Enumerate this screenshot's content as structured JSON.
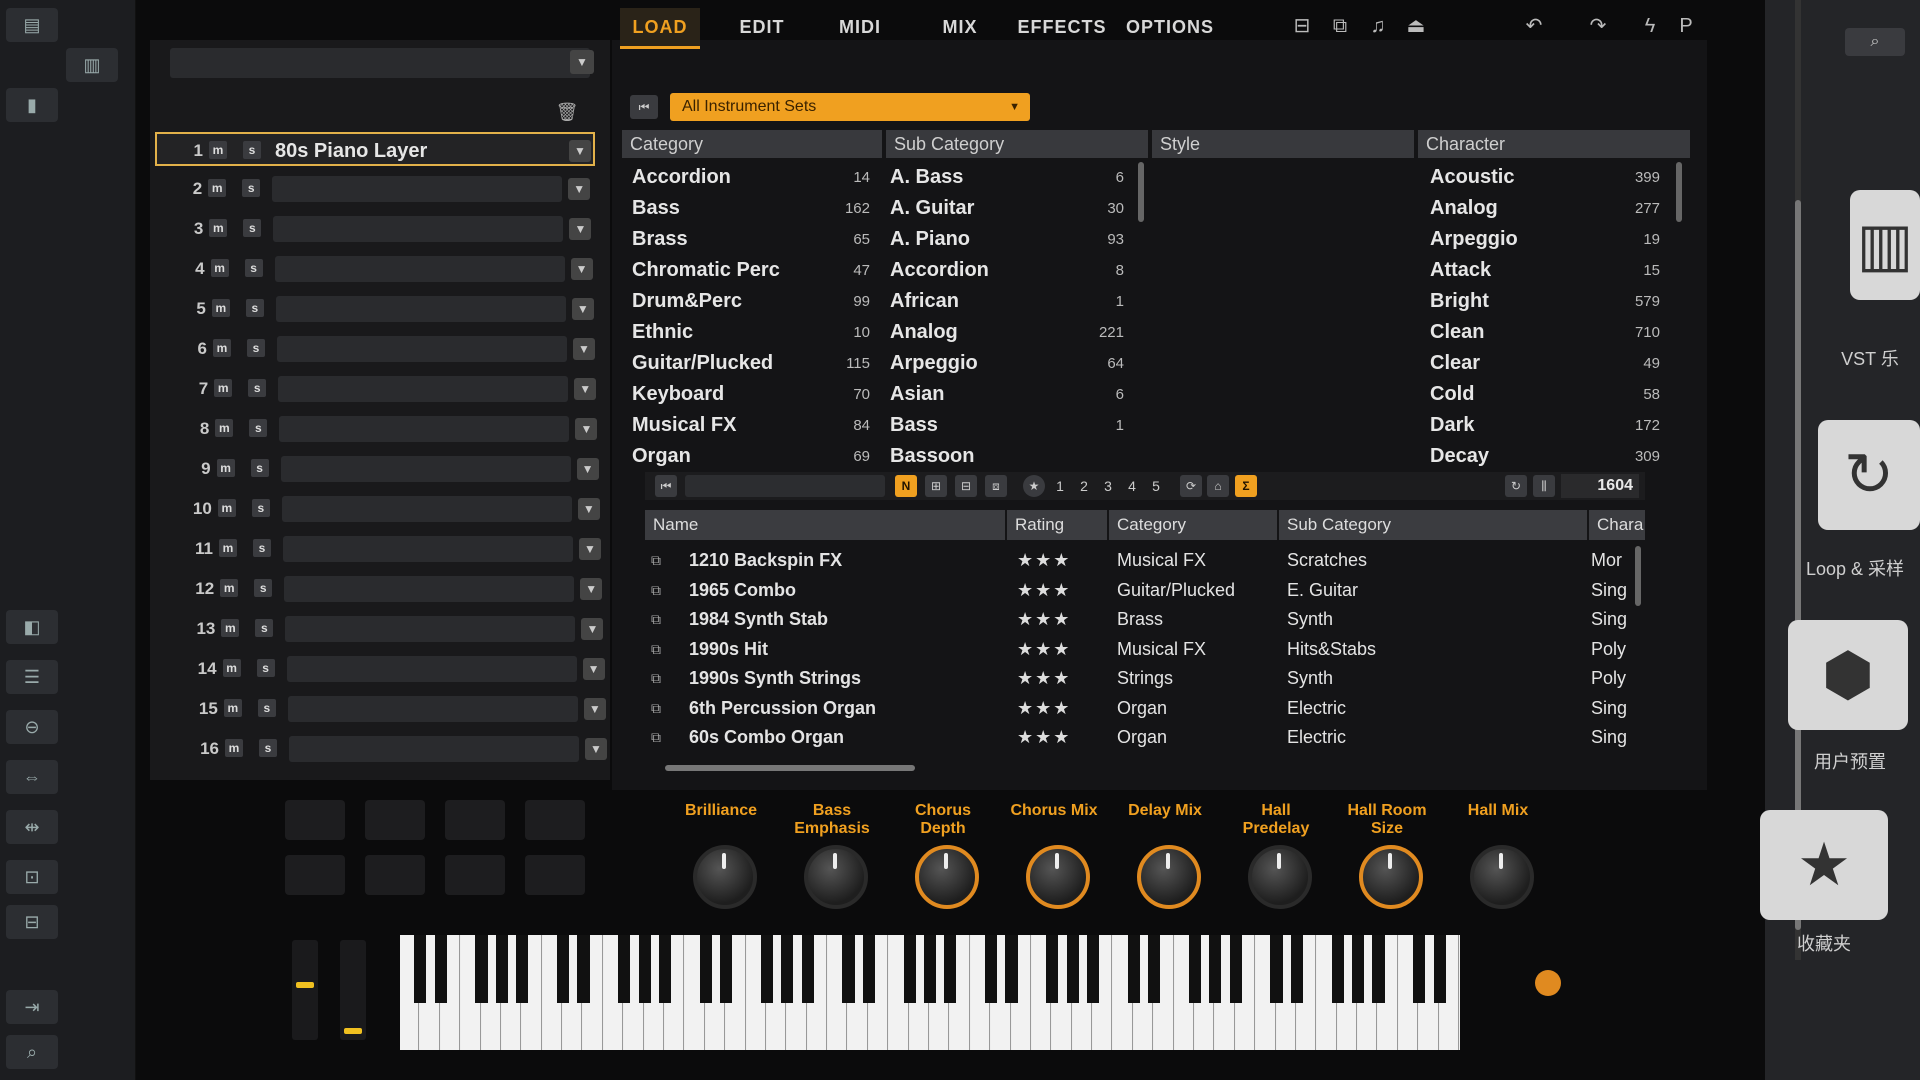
{
  "rack": {
    "slots": [
      {
        "num": "1",
        "name": "80s Piano Layer"
      },
      {
        "num": "2",
        "name": ""
      },
      {
        "num": "3",
        "name": ""
      },
      {
        "num": "4",
        "name": ""
      },
      {
        "num": "5",
        "name": ""
      },
      {
        "num": "6",
        "name": ""
      },
      {
        "num": "7",
        "name": ""
      },
      {
        "num": "8",
        "name": ""
      },
      {
        "num": "9",
        "name": ""
      },
      {
        "num": "10",
        "name": ""
      },
      {
        "num": "11",
        "name": ""
      },
      {
        "num": "12",
        "name": ""
      },
      {
        "num": "13",
        "name": ""
      },
      {
        "num": "14",
        "name": ""
      },
      {
        "num": "15",
        "name": ""
      },
      {
        "num": "16",
        "name": ""
      }
    ],
    "m_label": "m",
    "s_label": "s"
  },
  "tabs": [
    "LOAD",
    "EDIT",
    "MIDI",
    "MIX",
    "EFFECTS",
    "OPTIONS"
  ],
  "active_tab": "LOAD",
  "instrument_sets": "All Instrument Sets",
  "filters": {
    "category": {
      "header": "Category",
      "items": [
        {
          "label": "Accordion",
          "count": "14"
        },
        {
          "label": "Bass",
          "count": "162"
        },
        {
          "label": "Brass",
          "count": "65"
        },
        {
          "label": "Chromatic Perc",
          "count": "47"
        },
        {
          "label": "Drum&Perc",
          "count": "99"
        },
        {
          "label": "Ethnic",
          "count": "10"
        },
        {
          "label": "Guitar/Plucked",
          "count": "115"
        },
        {
          "label": "Keyboard",
          "count": "70"
        },
        {
          "label": "Musical FX",
          "count": "84"
        },
        {
          "label": "Organ",
          "count": "69"
        }
      ]
    },
    "subcategory": {
      "header": "Sub Category",
      "items": [
        {
          "label": "A. Bass",
          "count": "6"
        },
        {
          "label": "A. Guitar",
          "count": "30"
        },
        {
          "label": "A. Piano",
          "count": "93"
        },
        {
          "label": "Accordion",
          "count": "8"
        },
        {
          "label": "African",
          "count": "1"
        },
        {
          "label": "Analog",
          "count": "221"
        },
        {
          "label": "Arpeggio",
          "count": "64"
        },
        {
          "label": "Asian",
          "count": "6"
        },
        {
          "label": "Bass",
          "count": "1"
        },
        {
          "label": "Bassoon",
          "count": ""
        }
      ]
    },
    "style": {
      "header": "Style"
    },
    "character": {
      "header": "Character",
      "items": [
        {
          "label": "Acoustic",
          "count": "399"
        },
        {
          "label": "Analog",
          "count": "277"
        },
        {
          "label": "Arpeggio",
          "count": "19"
        },
        {
          "label": "Attack",
          "count": "15"
        },
        {
          "label": "Bright",
          "count": "579"
        },
        {
          "label": "Clean",
          "count": "710"
        },
        {
          "label": "Clear",
          "count": "49"
        },
        {
          "label": "Cold",
          "count": "58"
        },
        {
          "label": "Dark",
          "count": "172"
        },
        {
          "label": "Decay",
          "count": "309"
        }
      ]
    }
  },
  "result_toolbar": {
    "n_label": "N",
    "rating_filters": [
      "1",
      "2",
      "3",
      "4",
      "5"
    ],
    "sigma": "Σ",
    "result_count": "1604"
  },
  "results": {
    "headers": [
      "Name",
      "Rating",
      "Category",
      "Sub Category",
      "Chara"
    ],
    "rows": [
      {
        "name": "1210 Backspin FX",
        "rating": "★★★",
        "category": "Musical FX",
        "subcategory": "Scratches",
        "character": "Mor"
      },
      {
        "name": "1965 Combo",
        "rating": "★★★",
        "category": "Guitar/Plucked",
        "subcategory": "E. Guitar",
        "character": "Sing"
      },
      {
        "name": "1984 Synth Stab",
        "rating": "★★★",
        "category": "Brass",
        "subcategory": "Synth",
        "character": "Sing"
      },
      {
        "name": "1990s Hit",
        "rating": "★★★",
        "category": "Musical FX",
        "subcategory": "Hits&Stabs",
        "character": "Poly"
      },
      {
        "name": "1990s Synth Strings",
        "rating": "★★★",
        "category": "Strings",
        "subcategory": "Synth",
        "character": "Poly"
      },
      {
        "name": "6th Percussion Organ",
        "rating": "★★★",
        "category": "Organ",
        "subcategory": "Electric",
        "character": "Sing"
      },
      {
        "name": "60s Combo Organ",
        "rating": "★★★",
        "category": "Organ",
        "subcategory": "Electric",
        "character": "Sing"
      }
    ]
  },
  "knobs": [
    {
      "label": "Brilliance",
      "ring": false
    },
    {
      "label": "Bass Emphasis",
      "ring": false
    },
    {
      "label": "Chorus Depth",
      "ring": true
    },
    {
      "label": "Chorus Mix",
      "ring": true
    },
    {
      "label": "Delay Mix",
      "ring": true
    },
    {
      "label": "Hall Predelay",
      "ring": false
    },
    {
      "label": "Hall Room Size",
      "ring": true
    },
    {
      "label": "Hall Mix",
      "ring": false
    }
  ],
  "right_panel": {
    "vst_label": "VST 乐",
    "loop_label": "Loop & 采样",
    "user_preset_label": "用户预置",
    "favorites_label": "收藏夹"
  },
  "colors": {
    "accent": "#f0a020",
    "panel": "#141416",
    "header": "#38393d"
  }
}
